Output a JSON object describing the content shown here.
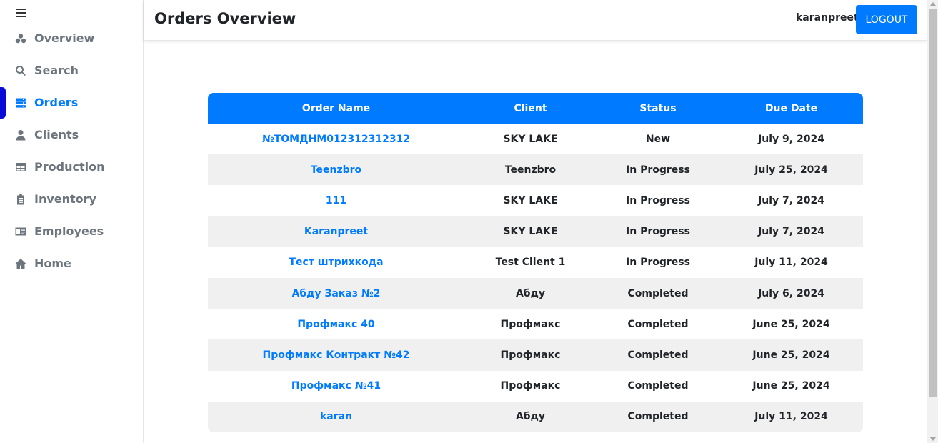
{
  "sidebar": {
    "items": [
      {
        "label": "Overview",
        "icon": "overview-icon",
        "active": false
      },
      {
        "label": "Search",
        "icon": "search-icon",
        "active": false
      },
      {
        "label": "Orders",
        "icon": "orders-icon",
        "active": true
      },
      {
        "label": "Clients",
        "icon": "user-icon",
        "active": false
      },
      {
        "label": "Production",
        "icon": "table-icon",
        "active": false
      },
      {
        "label": "Inventory",
        "icon": "clipboard-icon",
        "active": false
      },
      {
        "label": "Employees",
        "icon": "id-card-icon",
        "active": false
      },
      {
        "label": "Home",
        "icon": "home-icon",
        "active": false
      }
    ]
  },
  "header": {
    "title": "Orders Overview",
    "username": "karanpreet",
    "logout_label": "LOGOUT"
  },
  "table": {
    "columns": [
      "Order Name",
      "Client",
      "Status",
      "Due Date"
    ],
    "rows": [
      {
        "order": "№ТОМДНМ012312312312",
        "client": "SKY LAKE",
        "status": "New",
        "due": "July 9, 2024"
      },
      {
        "order": "Teenzbro",
        "client": "Teenzbro",
        "status": "In Progress",
        "due": "July 25, 2024"
      },
      {
        "order": "111",
        "client": "SKY LAKE",
        "status": "In Progress",
        "due": "July 7, 2024"
      },
      {
        "order": "Karanpreet",
        "client": "SKY LAKE",
        "status": "In Progress",
        "due": "July 7, 2024"
      },
      {
        "order": "Тест штрихкода",
        "client": "Test Client 1",
        "status": "In Progress",
        "due": "July 11, 2024"
      },
      {
        "order": "Абду Заказ №2",
        "client": "Абду",
        "status": "Completed",
        "due": "July 6, 2024"
      },
      {
        "order": "Профмакс 40",
        "client": "Профмакс",
        "status": "Completed",
        "due": "June 25, 2024"
      },
      {
        "order": "Профмакс Контракт №42",
        "client": "Профмакс",
        "status": "Completed",
        "due": "June 25, 2024"
      },
      {
        "order": "Профмакс №41",
        "client": "Профмакс",
        "status": "Completed",
        "due": "June 25, 2024"
      },
      {
        "order": "karan",
        "client": "Абду",
        "status": "Completed",
        "due": "July 11, 2024"
      }
    ]
  },
  "colors": {
    "accent": "#007bff",
    "active_marker": "#0a0ad8"
  }
}
